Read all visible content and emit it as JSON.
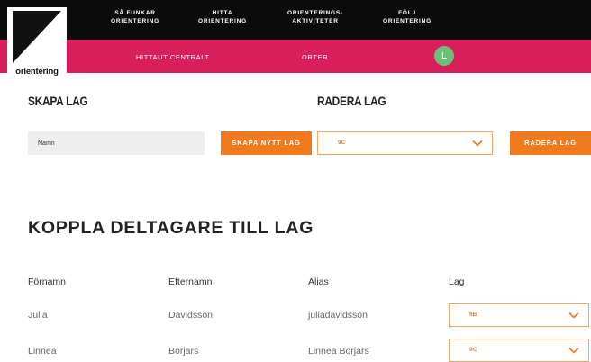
{
  "logo": {
    "text": "orientering"
  },
  "nav": {
    "items": [
      {
        "label": "SÅ FUNKAR\nORIENTERING"
      },
      {
        "label": "HITTA\nORIENTERING"
      },
      {
        "label": "ORIENTERINGS-\nAKTIVITETER"
      },
      {
        "label": "FÖLJ\nORIENTERING"
      }
    ]
  },
  "subnav": {
    "items": [
      {
        "label": "HITTAUT CENTRALT"
      },
      {
        "label": "ORTER"
      }
    ],
    "avatar": "L"
  },
  "create_team": {
    "title": "SKAPA LAG",
    "name_placeholder": "Namn",
    "button_label": "SKAPA NYTT LAG"
  },
  "delete_team": {
    "title": "RADERA LAG",
    "selected": "9C",
    "button_label": "RADERA LAG"
  },
  "assign": {
    "title": "KOPPLA DELTAGARE TILL LAG",
    "columns": [
      "Förnamn",
      "Efternamn",
      "Alias",
      "Lag"
    ],
    "rows": [
      {
        "first": "Julia",
        "last": "Davidsson",
        "alias": "juliadavidsson",
        "team": "9B"
      },
      {
        "first": "Linnea",
        "last": "Börjars",
        "alias": "Linnea Börjars",
        "team": "9C"
      }
    ]
  },
  "colors": {
    "topbar": "#0b0b0b",
    "subbar": "#d81e5b",
    "accent": "#f07a1e",
    "avatar": "#6fbe77"
  }
}
